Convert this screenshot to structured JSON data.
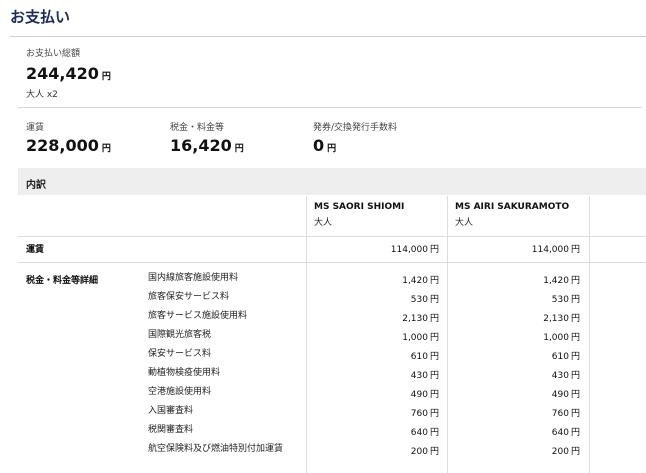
{
  "header": {
    "title": "お支払い"
  },
  "total": {
    "label": "お支払い総額",
    "amount": "244,420",
    "currency": "円",
    "pax": "大人 x2"
  },
  "summary": [
    {
      "label": "運賃",
      "amount": "228,000",
      "currency": "円"
    },
    {
      "label": "税金・料金等",
      "amount": "16,420",
      "currency": "円"
    },
    {
      "label": "発券/交換発行手数料",
      "amount": "0",
      "currency": "円"
    }
  ],
  "breakdown": {
    "title": "内訳",
    "passengers": [
      {
        "name": "MS SAORI SHIOMI",
        "type": "大人"
      },
      {
        "name": "MS AIRI SAKURAMOTO",
        "type": "大人"
      }
    ],
    "fare": {
      "label": "運賃",
      "values": [
        "114,000",
        "114,000"
      ],
      "currency": "円"
    },
    "taxes": {
      "label": "税金・料金等詳細",
      "items": [
        {
          "name": "国内線旅客施設使用料",
          "values": [
            "1,420",
            "1,420"
          ]
        },
        {
          "name": "旅客保安サービス料",
          "values": [
            "530",
            "530"
          ]
        },
        {
          "name": "旅客サービス施設使用料",
          "values": [
            "2,130",
            "2,130"
          ]
        },
        {
          "name": "国際観光旅客税",
          "values": [
            "1,000",
            "1,000"
          ]
        },
        {
          "name": "保安サービス料",
          "values": [
            "610",
            "610"
          ]
        },
        {
          "name": "動植物検疫使用料",
          "values": [
            "430",
            "430"
          ]
        },
        {
          "name": "空港施設使用料",
          "values": [
            "490",
            "490"
          ]
        },
        {
          "name": "入国審査料",
          "values": [
            "760",
            "760"
          ]
        },
        {
          "name": "税関審査料",
          "values": [
            "640",
            "640"
          ]
        },
        {
          "name": "航空保険料及び燃油特別付加運賃",
          "values": [
            "200",
            "200"
          ]
        }
      ],
      "currency": "円"
    }
  }
}
